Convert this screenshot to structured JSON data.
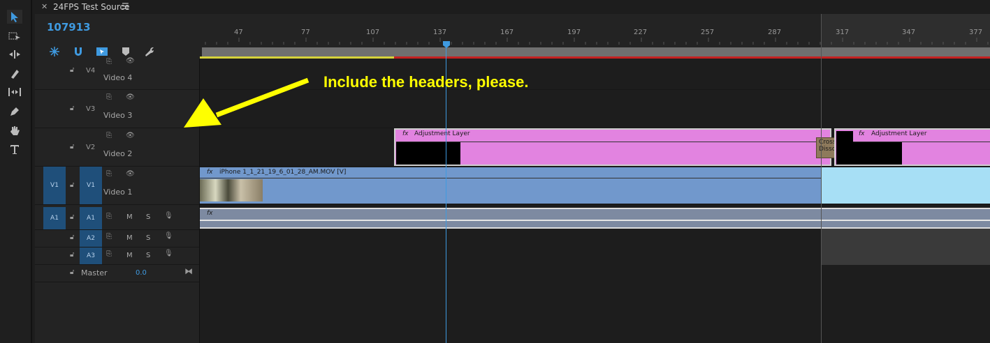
{
  "tab": {
    "title": "24FPS Test Source",
    "menu_icon": "hamburger-icon"
  },
  "timecode": "107913",
  "ruler": {
    "ticks": [
      "47",
      "77",
      "107",
      "137",
      "167",
      "197",
      "227",
      "257",
      "287",
      "317",
      "347",
      "377"
    ]
  },
  "annotation": {
    "text": "Include the headers, please.",
    "color": "#ffff00"
  },
  "tracks": {
    "video": [
      {
        "id": "V4",
        "name": "Video 4"
      },
      {
        "id": "V3",
        "name": "Video 3"
      },
      {
        "id": "V2",
        "name": "Video 2"
      },
      {
        "id": "V1",
        "name": "Video 1",
        "source": "V1"
      }
    ],
    "audio": [
      {
        "id": "A1",
        "source": "A1",
        "m": "M",
        "s": "S"
      },
      {
        "id": "A2",
        "m": "M",
        "s": "S"
      },
      {
        "id": "A3",
        "m": "M",
        "s": "S"
      }
    ],
    "master": {
      "name": "Master",
      "value": "0.0"
    }
  },
  "clips": {
    "adj1": "Adjustment Layer",
    "adj2": "Adjustment Layer",
    "transition": "Cross Disso",
    "video": "iPhone 1_1_21_19_6_01_28_AM.MOV [V]",
    "fx": "fx"
  },
  "colors": {
    "accent": "#3f9ae0",
    "adjustment": "#e283e0",
    "video_clip": "#7198cc",
    "video_clip_light": "#a7dff5",
    "track_target": "#1f4f7a"
  }
}
